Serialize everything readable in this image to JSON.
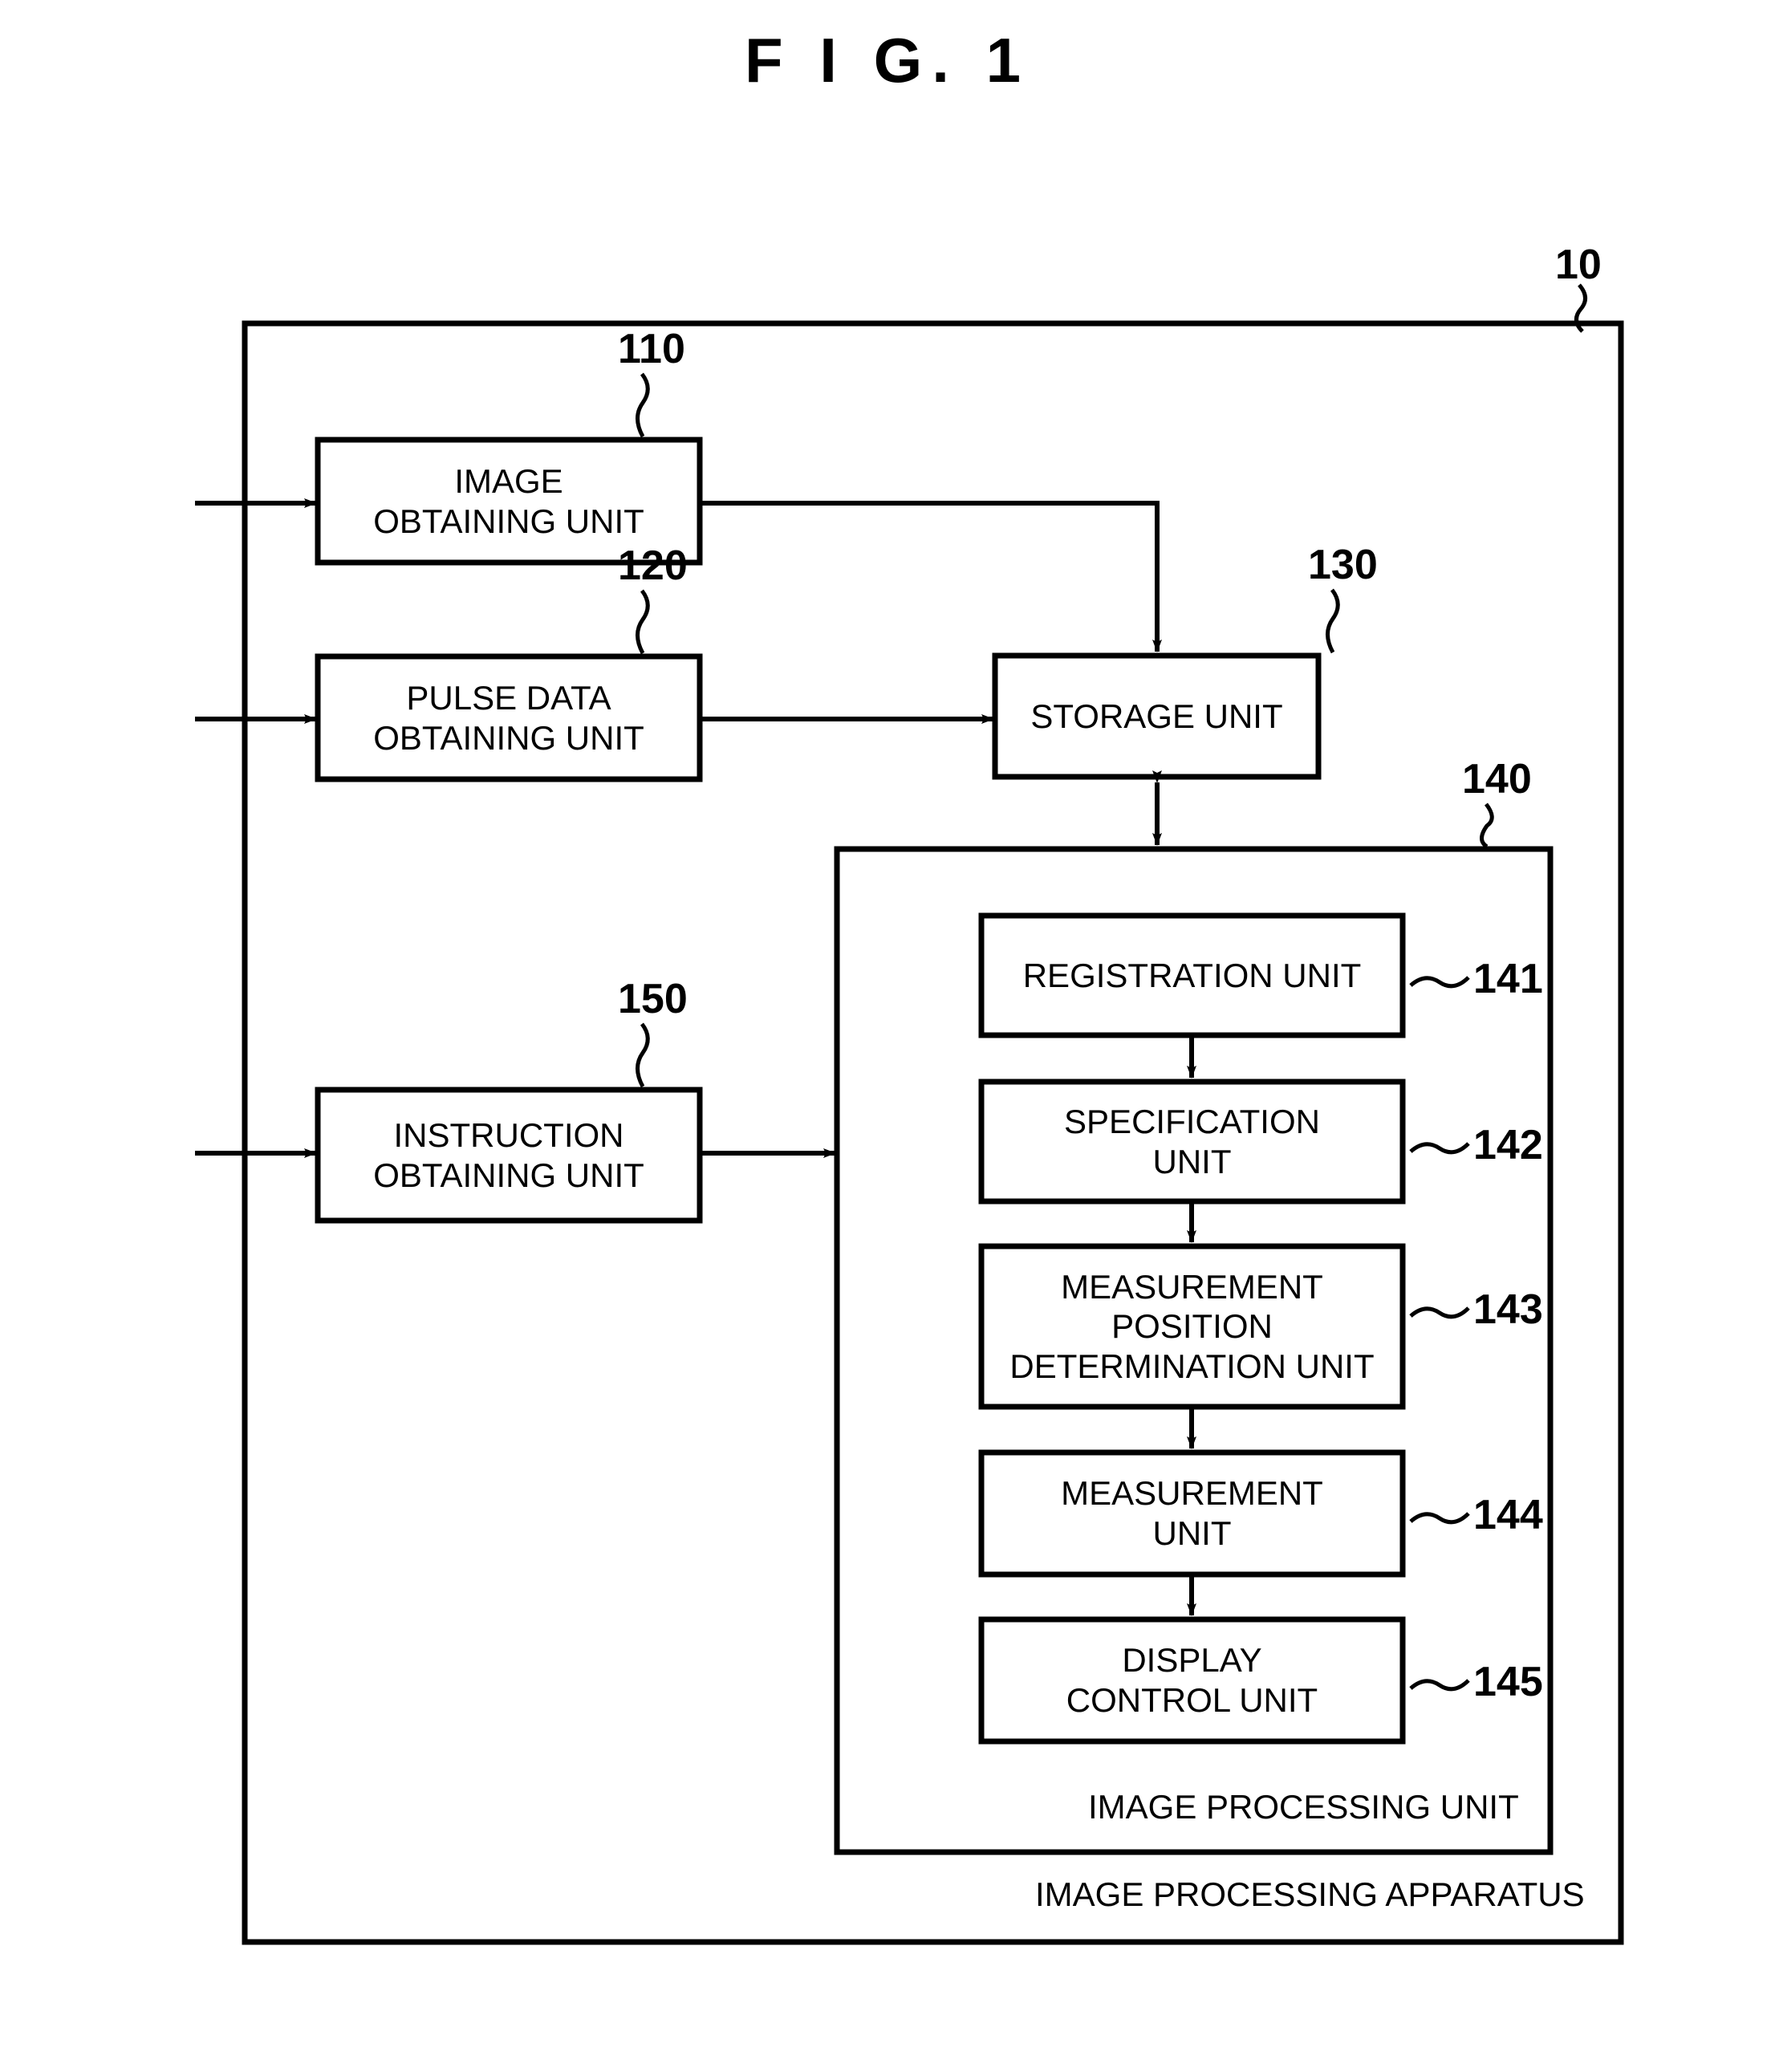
{
  "figure": {
    "title": "F I G. 1",
    "stroke_color": "#000000",
    "background_color": "#ffffff"
  },
  "outer_container": {
    "ref": "10",
    "label": "IMAGE PROCESSING APPARATUS"
  },
  "image_processing_unit": {
    "ref": "140",
    "label": "IMAGE PROCESSING UNIT"
  },
  "blocks": {
    "image_obtaining_unit": {
      "ref": "110",
      "line1": "IMAGE",
      "line2": "OBTAINING UNIT"
    },
    "pulse_data_obtaining_unit": {
      "ref": "120",
      "line1": "PULSE DATA",
      "line2": "OBTAINING UNIT"
    },
    "storage_unit": {
      "ref": "130",
      "line1": "STORAGE UNIT",
      "line2": ""
    },
    "instruction_obtaining_unit": {
      "ref": "150",
      "line1": "INSTRUCTION",
      "line2": "OBTAINING UNIT"
    },
    "registration_unit": {
      "ref": "141",
      "line1": "REGISTRATION UNIT",
      "line2": ""
    },
    "specification_unit": {
      "ref": "142",
      "line1": "SPECIFICATION",
      "line2": "UNIT"
    },
    "measurement_position_determination_unit": {
      "ref": "143",
      "line1": "MEASUREMENT",
      "line2": "POSITION",
      "line3": "DETERMINATION UNIT"
    },
    "measurement_unit": {
      "ref": "144",
      "line1": "MEASUREMENT",
      "line2": "UNIT"
    },
    "display_control_unit": {
      "ref": "145",
      "line1": "DISPLAY",
      "line2": "CONTROL UNIT"
    }
  },
  "connections": [
    {
      "name": "external-to-image-obtaining-unit",
      "from": "external",
      "to": "image_obtaining_unit",
      "arrow": "single"
    },
    {
      "name": "external-to-pulse-data-obtaining-unit",
      "from": "external",
      "to": "pulse_data_obtaining_unit",
      "arrow": "single"
    },
    {
      "name": "external-to-instruction-obtaining-unit",
      "from": "external",
      "to": "instruction_obtaining_unit",
      "arrow": "single"
    },
    {
      "name": "image-obtaining-unit-to-storage-unit",
      "from": "image_obtaining_unit",
      "to": "storage_unit",
      "arrow": "single"
    },
    {
      "name": "pulse-data-obtaining-unit-to-storage-unit",
      "from": "pulse_data_obtaining_unit",
      "to": "storage_unit",
      "arrow": "single"
    },
    {
      "name": "storage-unit-to-image-processing-unit",
      "from": "storage_unit",
      "to": "image_processing_unit",
      "arrow": "double"
    },
    {
      "name": "instruction-obtaining-unit-to-image-processing-unit",
      "from": "instruction_obtaining_unit",
      "to": "image_processing_unit",
      "arrow": "single"
    },
    {
      "name": "registration-unit-to-specification-unit",
      "from": "registration_unit",
      "to": "specification_unit",
      "arrow": "single"
    },
    {
      "name": "specification-unit-to-measurement-position-determination-unit",
      "from": "specification_unit",
      "to": "measurement_position_determination_unit",
      "arrow": "single"
    },
    {
      "name": "measurement-position-determination-unit-to-measurement-unit",
      "from": "measurement_position_determination_unit",
      "to": "measurement_unit",
      "arrow": "single"
    },
    {
      "name": "measurement-unit-to-display-control-unit",
      "from": "measurement_unit",
      "to": "display_control_unit",
      "arrow": "single"
    }
  ]
}
